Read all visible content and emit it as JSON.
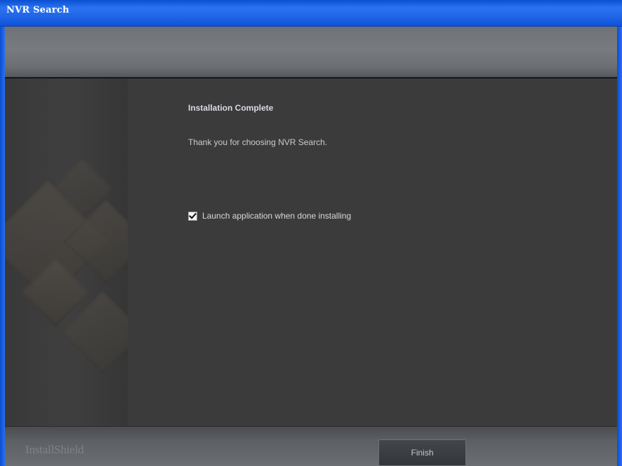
{
  "window": {
    "title": "NVR Search"
  },
  "content": {
    "heading": "Installation Complete",
    "message": "Thank you for choosing NVR Search.",
    "launch_checkbox": {
      "label": "Launch application when done installing",
      "checked": true
    }
  },
  "footer": {
    "brand": "InstallShield",
    "finish_label": "Finish"
  },
  "colors": {
    "titlebar": "#1e63e6",
    "background": "#3b3b3b",
    "banner": "#6f7276",
    "text": "#d9dbe1"
  },
  "icons": {
    "checkbox": "check-icon"
  }
}
